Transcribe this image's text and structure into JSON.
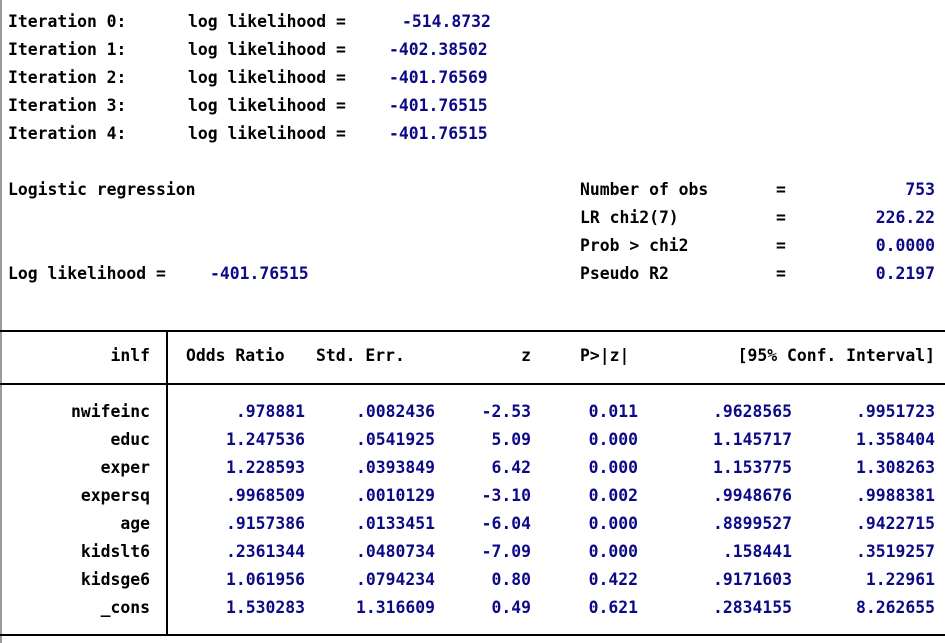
{
  "iterations": [
    {
      "label": "Iteration 0:",
      "ll_label": "log likelihood =",
      "value": "-514.8732"
    },
    {
      "label": "Iteration 1:",
      "ll_label": "log likelihood =",
      "value": "-402.38502"
    },
    {
      "label": "Iteration 2:",
      "ll_label": "log likelihood =",
      "value": "-401.76569"
    },
    {
      "label": "Iteration 3:",
      "ll_label": "log likelihood =",
      "value": "-401.76515"
    },
    {
      "label": "Iteration 4:",
      "ll_label": "log likelihood =",
      "value": "-401.76515"
    }
  ],
  "model_title": "Logistic regression",
  "loglik": {
    "label": "Log likelihood =",
    "value": "-401.76515"
  },
  "stats": [
    {
      "label": "Number of obs",
      "eq": "=",
      "value": "753"
    },
    {
      "label": "LR chi2(7)",
      "eq": "=",
      "value": "226.22"
    },
    {
      "label": "Prob > chi2",
      "eq": "=",
      "value": "0.0000"
    },
    {
      "label": "Pseudo R2",
      "eq": "=",
      "value": "0.2197"
    }
  ],
  "table": {
    "headers": {
      "var": "inlf",
      "or": "Odds Ratio",
      "se": "Std. Err.",
      "z": "z",
      "p": "P>|z|",
      "ci": "[95% Conf. Interval]"
    },
    "rows": [
      {
        "var": "nwifeinc",
        "or": ".978881",
        "se": ".0082436",
        "z": "-2.53",
        "p": "0.011",
        "lo": ".9628565",
        "hi": ".9951723"
      },
      {
        "var": "educ",
        "or": "1.247536",
        "se": ".0541925",
        "z": "5.09",
        "p": "0.000",
        "lo": "1.145717",
        "hi": "1.358404"
      },
      {
        "var": "exper",
        "or": "1.228593",
        "se": ".0393849",
        "z": "6.42",
        "p": "0.000",
        "lo": "1.153775",
        "hi": "1.308263"
      },
      {
        "var": "expersq",
        "or": ".9968509",
        "se": ".0010129",
        "z": "-3.10",
        "p": "0.002",
        "lo": ".9948676",
        "hi": ".9988381"
      },
      {
        "var": "age",
        "or": ".9157386",
        "se": ".0133451",
        "z": "-6.04",
        "p": "0.000",
        "lo": ".8899527",
        "hi": ".9422715"
      },
      {
        "var": "kidslt6",
        "or": ".2361344",
        "se": ".0480734",
        "z": "-7.09",
        "p": "0.000",
        "lo": ".158441",
        "hi": ".3519257"
      },
      {
        "var": "kidsge6",
        "or": "1.061956",
        "se": ".0794234",
        "z": "0.80",
        "p": "0.422",
        "lo": ".9171603",
        "hi": "1.22961"
      },
      {
        "var": "_cons",
        "or": "1.530283",
        "se": "1.316609",
        "z": "0.49",
        "p": "0.621",
        "lo": ".2834155",
        "hi": "8.262655"
      }
    ]
  }
}
